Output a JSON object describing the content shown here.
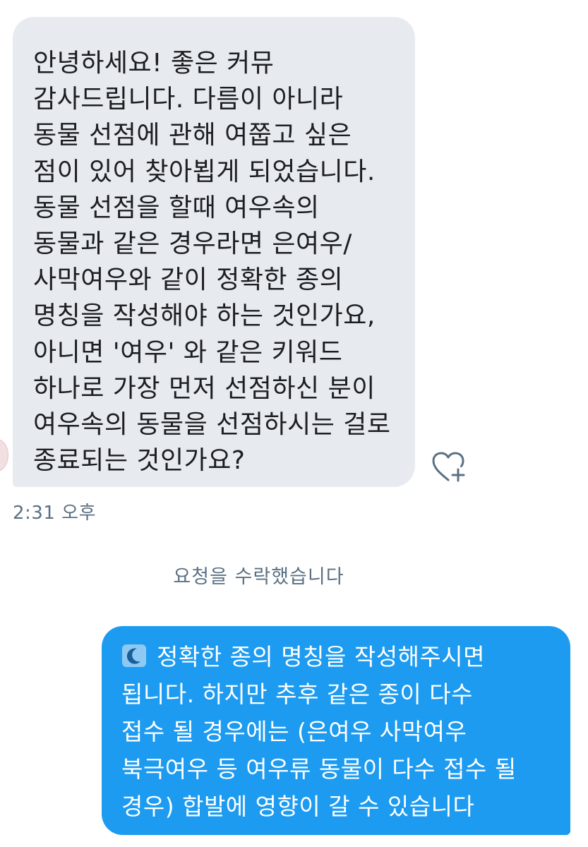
{
  "conversation": {
    "received_message": {
      "lines": [
        "안녕하세요! 좋은 커뮤",
        "감사드립니다. 다름이 아니라",
        "동물 선점에 관해 여쭙고 싶은",
        "점이 있어 찾아뵙게 되었습니다.",
        "동물 선점을 할때 여우속의",
        "동물과 같은 경우라면 은여우/",
        "사막여우와 같이 정확한 종의",
        "명칭을 작성해야 하는 것인가요,",
        "아니면 '여우' 와 같은 키워드",
        "하나로 가장 먼저 선점하신 분이",
        "여우속의 동물을 선점하시는 걸로",
        "종료되는 것인가요?"
      ],
      "timestamp": "2:31 오후"
    },
    "like_icon": "heart-plus-icon",
    "system_message": "요청을 수락했습니다",
    "sent_message": {
      "emoji_icon": "crescent-moon-icon",
      "lines": [
        "정확한 종의 명칭을 작성해주시면",
        "됩니다. 하지만 추후 같은 종이 다수",
        "접수 될 경우에는 (은여우 사막여우",
        "북극여우 등 여우류 동물이 다수 접수 될",
        "경우) 합발에 영향이 갈 수 있습니다"
      ]
    }
  },
  "colors": {
    "received_bubble": "#e7ebef",
    "sent_bubble": "#1d9bf0",
    "secondary_text": "#5b7083"
  }
}
